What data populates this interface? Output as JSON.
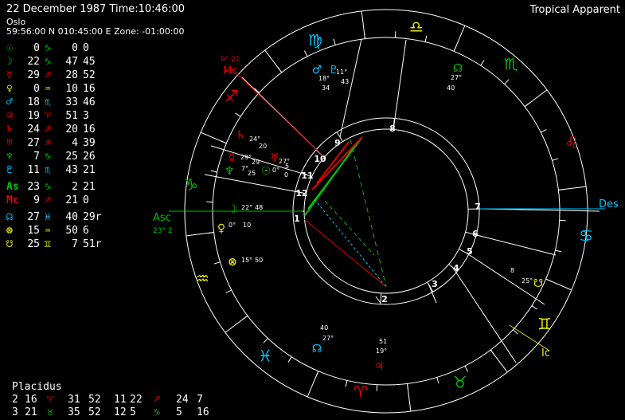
{
  "header": {
    "date_time": "22 December 1987   Time:10:46:00",
    "place": "Oslo",
    "coords": "59:56:00 N 010:45:00 E  Zone: -01:00:00",
    "mode": "Tropical Apparent"
  },
  "colors": {
    "green": "#00c000",
    "red": "#e00000",
    "cyan": "#00c8ff",
    "yellow": "#e8e800",
    "white": "#ffffff"
  },
  "planets": [
    {
      "symbol": "☉",
      "name": "sun",
      "color": "#00c000",
      "deg": "0",
      "sign": "♑",
      "sign_color": "#00c000",
      "min": "0",
      "sec": "0"
    },
    {
      "symbol": "☽",
      "name": "moon",
      "color": "#00c000",
      "deg": "22",
      "sign": "♑",
      "sign_color": "#00c000",
      "min": "47",
      "sec": "45"
    },
    {
      "symbol": "☿",
      "name": "mercury",
      "color": "#e00000",
      "deg": "29",
      "sign": "♐",
      "sign_color": "#e00000",
      "min": "28",
      "sec": "52"
    },
    {
      "symbol": "♀",
      "name": "venus",
      "color": "#e8e800",
      "deg": "0",
      "sign": "♒",
      "sign_color": "#e8e800",
      "min": "10",
      "sec": "16"
    },
    {
      "symbol": "♂",
      "name": "mars",
      "color": "#00c8ff",
      "deg": "18",
      "sign": "♏",
      "sign_color": "#00c8ff",
      "min": "33",
      "sec": "46"
    },
    {
      "symbol": "♃",
      "name": "jupiter",
      "color": "#e00000",
      "deg": "19",
      "sign": "♈",
      "sign_color": "#e00000",
      "min": "51",
      "sec": "3"
    },
    {
      "symbol": "♄",
      "name": "saturn",
      "color": "#e00000",
      "deg": "24",
      "sign": "♐",
      "sign_color": "#e00000",
      "min": "20",
      "sec": "16"
    },
    {
      "symbol": "♅",
      "name": "uranus",
      "color": "#e00000",
      "deg": "27",
      "sign": "♐",
      "sign_color": "#e00000",
      "min": "4",
      "sec": "39"
    },
    {
      "symbol": "♆",
      "name": "neptune",
      "color": "#00c000",
      "deg": "7",
      "sign": "♑",
      "sign_color": "#00c000",
      "min": "25",
      "sec": "26"
    },
    {
      "symbol": "♇",
      "name": "pluto",
      "color": "#00c8ff",
      "deg": "11",
      "sign": "♏",
      "sign_color": "#00c8ff",
      "min": "43",
      "sec": "21"
    },
    {
      "symbol": "As",
      "name": "ascendant",
      "color": "#00c000",
      "deg": "23",
      "sign": "♑",
      "sign_color": "#00c000",
      "min": "2",
      "sec": "21",
      "gap": true
    },
    {
      "symbol": "Mc",
      "name": "midheaven",
      "color": "#e00000",
      "deg": "9",
      "sign": "♐",
      "sign_color": "#e00000",
      "min": "21",
      "sec": "0"
    },
    {
      "symbol": "☊",
      "name": "node",
      "color": "#00c8ff",
      "deg": "27",
      "sign": "♓",
      "sign_color": "#00c8ff",
      "min": "40",
      "sec": "29r",
      "gap": true
    },
    {
      "symbol": "⊗",
      "name": "fortune",
      "color": "#e8e800",
      "deg": "15",
      "sign": "♒",
      "sign_color": "#e8e800",
      "min": "50",
      "sec": "6"
    },
    {
      "symbol": "☋",
      "name": "lilith",
      "color": "#e8e800",
      "deg": "25",
      "sign": "♊",
      "sign_color": "#e8e800",
      "min": "7",
      "sec": "51r"
    }
  ],
  "houses": {
    "title": "Placidus",
    "rows": [
      {
        "h1": "2",
        "d1": "16",
        "s1": "♈",
        "c1": "#e00000",
        "m1": "31",
        "x1": "52",
        "h2": "11",
        "d2": "22",
        "s2": "♐",
        "c2": "#e00000",
        "m2": "24",
        "x2": "7"
      },
      {
        "h1": "3",
        "d1": "21",
        "s1": "♉",
        "c1": "#00c000",
        "m1": "35",
        "x1": "52",
        "h2": "12",
        "d2": "5",
        "s2": "♑",
        "c2": "#00c000",
        "m2": "5",
        "x2": "16"
      }
    ]
  },
  "wheel": {
    "zodiac": [
      {
        "glyph": "♍",
        "color": "#00c8ff"
      },
      {
        "glyph": "♎",
        "color": "#e8e800"
      },
      {
        "glyph": "♏",
        "color": "#00c000"
      },
      {
        "glyph": "♌",
        "color": "#e00000"
      },
      {
        "glyph": "♋",
        "color": "#00c8ff"
      },
      {
        "glyph": "♊",
        "color": "#e8e800"
      },
      {
        "glyph": "♉",
        "color": "#00c000"
      },
      {
        "glyph": "♈",
        "color": "#e00000"
      },
      {
        "glyph": "♓",
        "color": "#00c8ff"
      },
      {
        "glyph": "♒",
        "color": "#e8e800"
      },
      {
        "glyph": "♑",
        "color": "#00c000"
      },
      {
        "glyph": "♐",
        "color": "#e00000"
      }
    ],
    "house_numbers": [
      "1",
      "2",
      "3",
      "4",
      "5",
      "6",
      "7",
      "8",
      "9",
      "10",
      "11",
      "12"
    ],
    "labels": {
      "asc": "Asc",
      "asc_deg": "23° 2",
      "des": "Des",
      "mc": "Mc",
      "mc_deg": "9° 21",
      "ic": "Ic"
    },
    "planet_labels": [
      {
        "glyph": "♂",
        "color": "#00c8ff",
        "deg": "18°",
        "min": "34"
      },
      {
        "glyph": "♇",
        "color": "#00c8ff",
        "deg": "11°",
        "min": "43"
      },
      {
        "glyph": "☊",
        "color": "#00c000",
        "deg": "27°",
        "min": "40"
      },
      {
        "glyph": "♄",
        "color": "#e00000",
        "deg": "24°",
        "min": "20"
      },
      {
        "glyph": "♅",
        "color": "#e00000",
        "deg": "27°",
        "min": "5"
      },
      {
        "glyph": "☿",
        "color": "#e00000",
        "deg": "29°",
        "min": "29"
      },
      {
        "glyph": "☉",
        "color": "#00c000",
        "deg": "0°",
        "min": "0"
      },
      {
        "glyph": "♆",
        "color": "#00c000",
        "deg": "7°",
        "min": "25"
      },
      {
        "glyph": "☽",
        "color": "#00c000",
        "deg": "22°",
        "min": "48"
      },
      {
        "glyph": "♀",
        "color": "#e8e800",
        "deg": "0°",
        "min": "10"
      },
      {
        "glyph": "⊗",
        "color": "#e8e800",
        "deg": "15°",
        "min": "50"
      },
      {
        "glyph": "☊",
        "color": "#00c8ff",
        "deg": "27°",
        "min": "40"
      },
      {
        "glyph": "♃",
        "color": "#e00000",
        "deg": "19°",
        "min": "51"
      },
      {
        "glyph": "☋",
        "color": "#e8e800",
        "deg": "25°",
        "min": "8"
      }
    ]
  }
}
